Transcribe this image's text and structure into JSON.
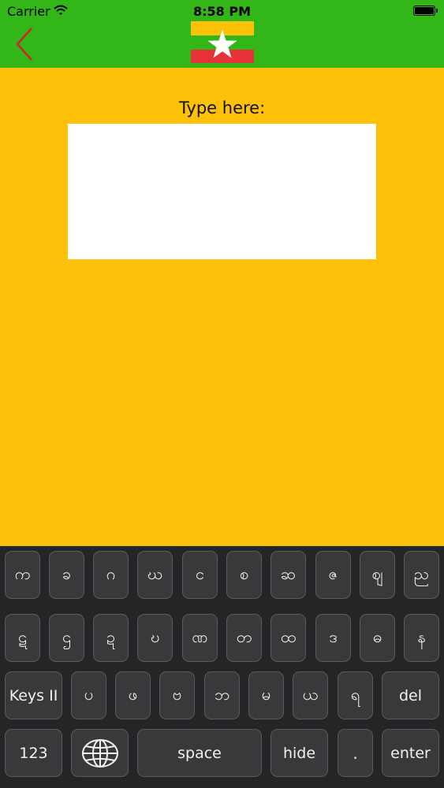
{
  "status": {
    "carrier": "Carrier",
    "time": "8:58 PM",
    "wifi_icon": "wifi-icon",
    "battery_icon": "battery-icon"
  },
  "nav": {
    "back_icon": "chevron-left-icon",
    "flag_icon": "myanmar-flag-icon",
    "back_color": "#d0262b",
    "bar_color": "#33b618"
  },
  "main": {
    "prompt": "Type here:",
    "input_value": "",
    "background": "#fdc10a"
  },
  "keyboard": {
    "row1": [
      "က",
      "ခ",
      "ဂ",
      "ဃ",
      "င",
      "စ",
      "ဆ",
      "ဇ",
      "ဈ",
      "ည"
    ],
    "row2": [
      "ဋ",
      "ဌ",
      "ဍ",
      "ဎ",
      "ဏ",
      "တ",
      "ထ",
      "ဒ",
      "ဓ",
      "န"
    ],
    "row3": [
      "Keys II",
      "ပ",
      "ဖ",
      "ဗ",
      "ဘ",
      "မ",
      "ယ",
      "ရ",
      "del"
    ],
    "row4": [
      "123",
      "globe",
      "space",
      "hide",
      ".",
      "enter"
    ],
    "globe_icon": "globe-icon"
  }
}
